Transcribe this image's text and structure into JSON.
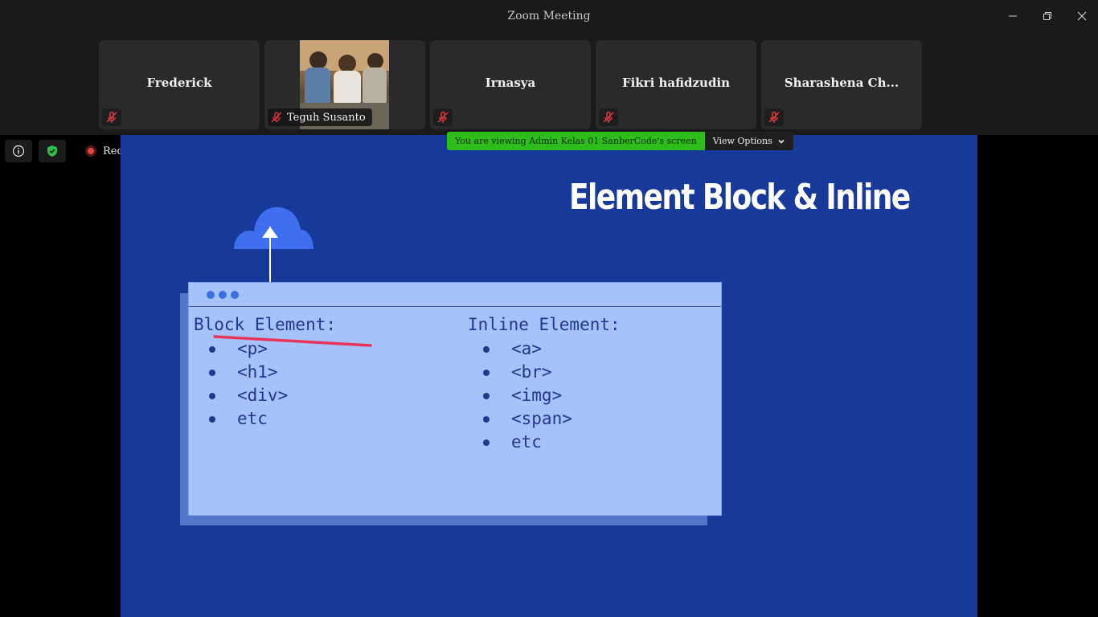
{
  "window": {
    "title": "Zoom Meeting"
  },
  "participants": [
    {
      "name": "Frederick",
      "muted": true
    },
    {
      "name": "Teguh Susanto",
      "muted": true,
      "video": true
    },
    {
      "name": "Irnasya",
      "muted": true
    },
    {
      "name": "Fikri hafidzudin",
      "muted": true
    },
    {
      "name": "Sharashena Ch...",
      "muted": true
    }
  ],
  "toolbar": {
    "recording_label": "Recording"
  },
  "share": {
    "banner_text": "You are viewing Admin Kelas 01 SanberCode's screen",
    "view_options_label": "View Options"
  },
  "slide": {
    "title": "Element Block & Inline",
    "block": {
      "heading": "Block Element:",
      "items": [
        "<p>",
        "<h1>",
        "<div>",
        "etc"
      ]
    },
    "inline": {
      "heading": "Inline Element:",
      "items": [
        "<a>",
        "<br>",
        "<img>",
        "<span>",
        "etc"
      ]
    }
  },
  "colors": {
    "share_bg": "#173a9a",
    "card_bg": "#a6c2fb",
    "banner_green": "#2ebd1a",
    "mute_red": "#e0383a"
  }
}
